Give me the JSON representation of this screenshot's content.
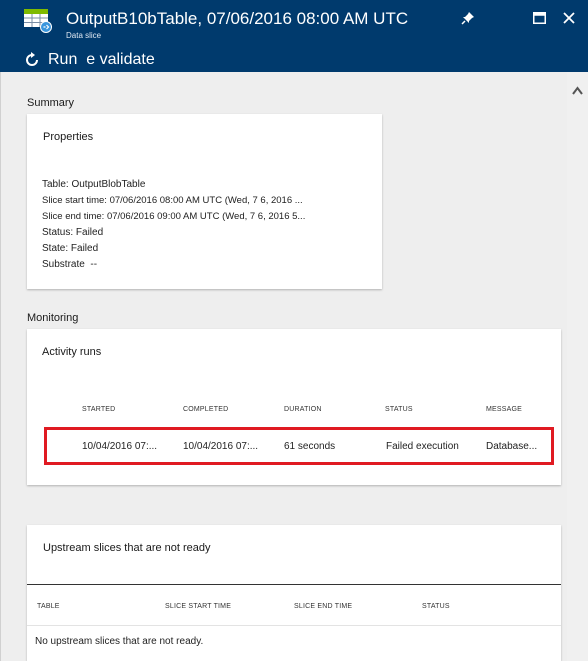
{
  "header": {
    "title": "OutputB10bTable, 07/06/2016 08:00 AM UTC",
    "subtitle": "Data slice",
    "command_label": "Run  e validate",
    "icons": [
      "table-icon",
      "pin-icon",
      "maximize-icon",
      "close-icon",
      "rerun-icon"
    ]
  },
  "summary": {
    "section_label": "Summary",
    "card_title": "Properties",
    "lines": [
      "Table: OutputBlobTable",
      "Slice start time: 07/06/2016 08:00 AM UTC (Wed, 7 6, 2016 ...",
      "Slice end time: 07/06/2016 09:00 AM UTC (Wed, 7 6, 2016 5...",
      "Status: Failed",
      "State: Failed",
      "Substrate  --"
    ]
  },
  "monitoring": {
    "section_label": "Monitoring",
    "card_title": "Activity runs",
    "columns": [
      "STARTED",
      "COMPLETED",
      "DURATION",
      "STATUS",
      "MESSAGE"
    ],
    "row": {
      "started": "10/04/2016 07:...",
      "completed": "10/04/2016 07:...",
      "duration": "61 seconds",
      "status": "Failed execution",
      "message": "Database..."
    }
  },
  "upstream": {
    "card_title": "Upstream slices that are not ready",
    "columns": [
      "TABLE",
      "SLICE START TIME",
      "SLICE END TIME",
      "STATUS"
    ],
    "empty_message": "No upstream slices that are not ready."
  },
  "colors": {
    "header_bg": "#003a6d",
    "highlight": "#e01a22",
    "content_bg": "#eeeeee"
  }
}
